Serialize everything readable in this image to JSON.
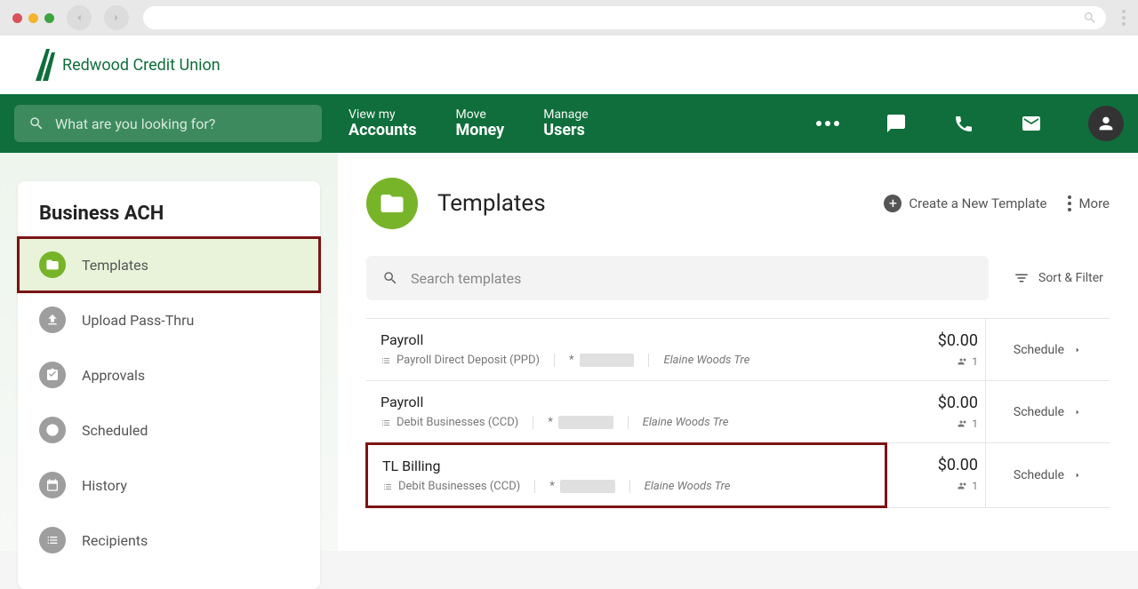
{
  "brand_name": "Redwood Credit Union",
  "search_placeholder": "What are you looking for?",
  "nav": {
    "accounts_small": "View my",
    "accounts_big": "Accounts",
    "money_small": "Move",
    "money_big": "Money",
    "users_small": "Manage",
    "users_big": "Users"
  },
  "sidebar": {
    "title": "Business ACH",
    "items": [
      {
        "label": "Templates"
      },
      {
        "label": "Upload Pass-Thru"
      },
      {
        "label": "Approvals"
      },
      {
        "label": "Scheduled"
      },
      {
        "label": "History"
      },
      {
        "label": "Recipients"
      }
    ]
  },
  "page_title": "Templates",
  "actions": {
    "create": "Create a New Template",
    "more": "More",
    "sort_filter": "Sort & Filter",
    "search_placeholder": "Search templates"
  },
  "schedule_label": "Schedule",
  "templates": [
    {
      "name": "Payroll",
      "type": "Payroll Direct Deposit (PPD)",
      "acct": "*",
      "owner": "Elaine Woods Tre",
      "amount": "$0.00",
      "recipients": "1"
    },
    {
      "name": "Payroll",
      "type": "Debit Businesses (CCD)",
      "acct": "*",
      "owner": "Elaine Woods Tre",
      "amount": "$0.00",
      "recipients": "1"
    },
    {
      "name": "TL Billing",
      "type": "Debit Businesses (CCD)",
      "acct": "*",
      "owner": "Elaine Woods Tre",
      "amount": "$0.00",
      "recipients": "1"
    }
  ]
}
